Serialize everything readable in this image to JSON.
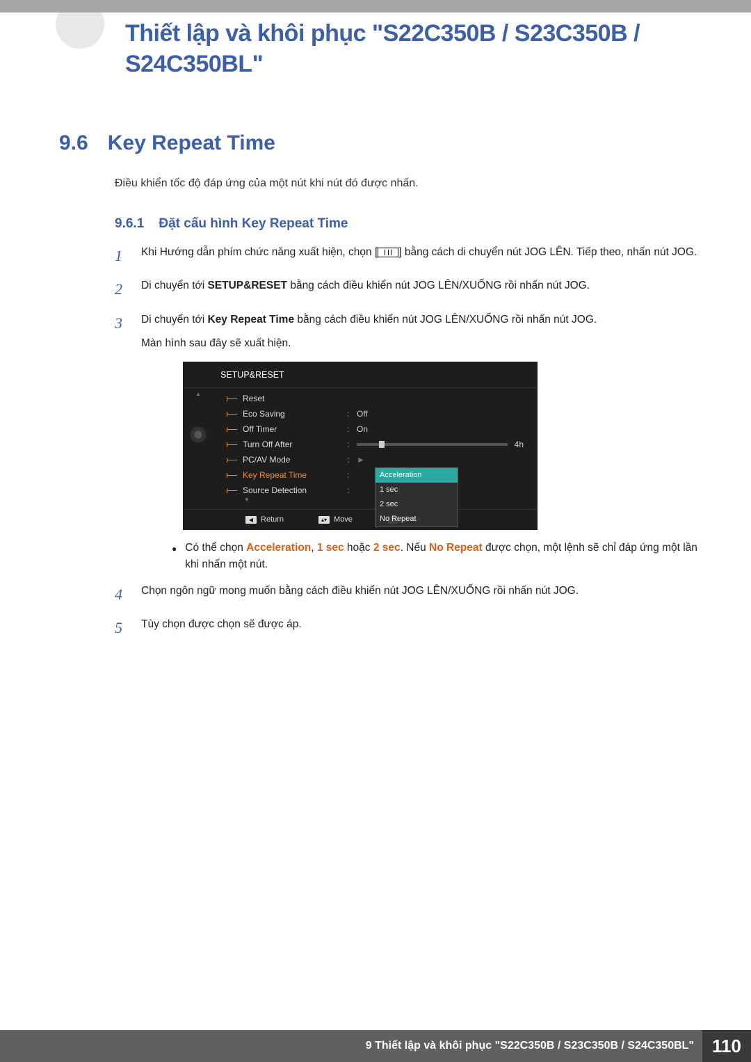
{
  "header": {
    "chapter_title": "Thiết lập và khôi phục \"S22C350B / S23C350B / S24C350BL\""
  },
  "section": {
    "number": "9.6",
    "title": "Key Repeat Time",
    "intro": "Điều khiển tốc độ đáp ứng của một nút khi nút đó được nhấn."
  },
  "subsection": {
    "number": "9.6.1",
    "title": "Đặt cấu hình Key Repeat Time"
  },
  "steps": {
    "s1": {
      "num": "1",
      "pre": "Khi Hướng dẫn phím chức năng xuất hiện, chọn [",
      "post": "] bằng cách di chuyển nút JOG LÊN. Tiếp theo, nhấn nút JOG."
    },
    "s2": {
      "num": "2",
      "pre": "Di chuyển tới ",
      "bold": "SETUP&RESET",
      "post": " bằng cách điều khiển nút JOG LÊN/XUỐNG rồi nhấn nút JOG."
    },
    "s3": {
      "num": "3",
      "pre": "Di chuyển tới ",
      "bold": "Key Repeat Time",
      "post": " bằng cách điều khiển nút JOG LÊN/XUỐNG rồi nhấn nút JOG.",
      "note": "Màn hình sau đây sẽ xuất hiện."
    },
    "s4": {
      "num": "4",
      "text": "Chọn ngôn ngữ mong muốn bằng cách điều khiển nút JOG LÊN/XUỐNG rồi nhấn nút JOG."
    },
    "s5": {
      "num": "5",
      "text": "Tùy chọn được chọn sẽ được áp."
    }
  },
  "osd": {
    "title": "SETUP&RESET",
    "rows": {
      "reset": {
        "label": "Reset"
      },
      "eco": {
        "label": "Eco Saving",
        "val": "Off"
      },
      "offtimer": {
        "label": "Off Timer",
        "val": "On"
      },
      "turnoff": {
        "label": "Turn Off After",
        "val": "4h"
      },
      "pcav": {
        "label": "PC/AV Mode"
      },
      "krt": {
        "label": "Key Repeat Time"
      },
      "src": {
        "label": "Source Detection"
      }
    },
    "dropdown": {
      "opt1": "Acceleration",
      "opt2": "1 sec",
      "opt3": "2 sec",
      "opt4": "No Repeat"
    },
    "footer": {
      "return": "Return",
      "move": "Move",
      "enter": "Enter"
    }
  },
  "bullet": {
    "pre": "Có thể chọn ",
    "accel": "Acceleration",
    "c1": ", ",
    "sec1": "1 sec",
    "or": " hoặc ",
    "sec2": "2 sec",
    "mid": ". Nếu ",
    "norep": "No Repeat",
    "post": " được chọn, một lệnh sẽ chỉ đáp ứng một lần khi nhấn một nút."
  },
  "footer": {
    "text": "9 Thiết lập và khôi phục \"S22C350B / S23C350B / S24C350BL\"",
    "page": "110"
  }
}
